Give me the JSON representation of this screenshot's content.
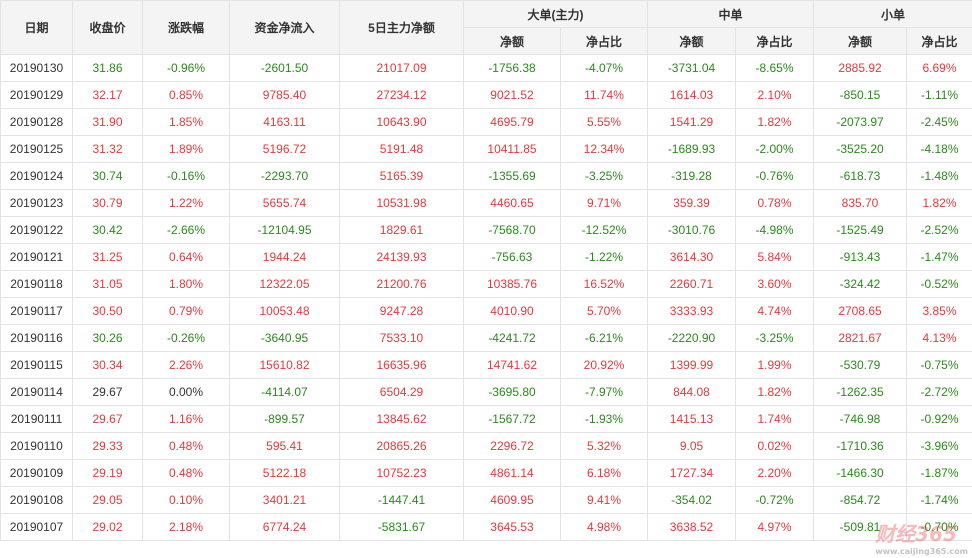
{
  "headers": {
    "date": "日期",
    "close": "收盘价",
    "change": "涨跌幅",
    "netflow": "资金净流入",
    "main5d": "5日主力净额",
    "large": "大单(主力)",
    "medium": "中单",
    "small": "小单",
    "net": "净额",
    "ratio": "净占比"
  },
  "colors": {
    "up": "#e4393c",
    "down": "#2a8a1b",
    "neutral": "#333333"
  },
  "rows": [
    {
      "date": "20190130",
      "close": "31.86",
      "change": "-0.96%",
      "netflow": "-2601.50",
      "main5d": "21017.09",
      "l_net": "-1756.38",
      "l_ratio": "-4.07%",
      "m_net": "-3731.04",
      "m_ratio": "-8.65%",
      "s_net": "2885.92",
      "s_ratio": "6.69%"
    },
    {
      "date": "20190129",
      "close": "32.17",
      "change": "0.85%",
      "netflow": "9785.40",
      "main5d": "27234.12",
      "l_net": "9021.52",
      "l_ratio": "11.74%",
      "m_net": "1614.03",
      "m_ratio": "2.10%",
      "s_net": "-850.15",
      "s_ratio": "-1.11%"
    },
    {
      "date": "20190128",
      "close": "31.90",
      "change": "1.85%",
      "netflow": "4163.11",
      "main5d": "10643.90",
      "l_net": "4695.79",
      "l_ratio": "5.55%",
      "m_net": "1541.29",
      "m_ratio": "1.82%",
      "s_net": "-2073.97",
      "s_ratio": "-2.45%"
    },
    {
      "date": "20190125",
      "close": "31.32",
      "change": "1.89%",
      "netflow": "5196.72",
      "main5d": "5191.48",
      "l_net": "10411.85",
      "l_ratio": "12.34%",
      "m_net": "-1689.93",
      "m_ratio": "-2.00%",
      "s_net": "-3525.20",
      "s_ratio": "-4.18%"
    },
    {
      "date": "20190124",
      "close": "30.74",
      "change": "-0.16%",
      "netflow": "-2293.70",
      "main5d": "5165.39",
      "l_net": "-1355.69",
      "l_ratio": "-3.25%",
      "m_net": "-319.28",
      "m_ratio": "-0.76%",
      "s_net": "-618.73",
      "s_ratio": "-1.48%"
    },
    {
      "date": "20190123",
      "close": "30.79",
      "change": "1.22%",
      "netflow": "5655.74",
      "main5d": "10531.98",
      "l_net": "4460.65",
      "l_ratio": "9.71%",
      "m_net": "359.39",
      "m_ratio": "0.78%",
      "s_net": "835.70",
      "s_ratio": "1.82%"
    },
    {
      "date": "20190122",
      "close": "30.42",
      "change": "-2.66%",
      "netflow": "-12104.95",
      "main5d": "1829.61",
      "l_net": "-7568.70",
      "l_ratio": "-12.52%",
      "m_net": "-3010.76",
      "m_ratio": "-4.98%",
      "s_net": "-1525.49",
      "s_ratio": "-2.52%"
    },
    {
      "date": "20190121",
      "close": "31.25",
      "change": "0.64%",
      "netflow": "1944.24",
      "main5d": "24139.93",
      "l_net": "-756.63",
      "l_ratio": "-1.22%",
      "m_net": "3614.30",
      "m_ratio": "5.84%",
      "s_net": "-913.43",
      "s_ratio": "-1.47%"
    },
    {
      "date": "20190118",
      "close": "31.05",
      "change": "1.80%",
      "netflow": "12322.05",
      "main5d": "21200.76",
      "l_net": "10385.76",
      "l_ratio": "16.52%",
      "m_net": "2260.71",
      "m_ratio": "3.60%",
      "s_net": "-324.42",
      "s_ratio": "-0.52%"
    },
    {
      "date": "20190117",
      "close": "30.50",
      "change": "0.79%",
      "netflow": "10053.48",
      "main5d": "9247.28",
      "l_net": "4010.90",
      "l_ratio": "5.70%",
      "m_net": "3333.93",
      "m_ratio": "4.74%",
      "s_net": "2708.65",
      "s_ratio": "3.85%"
    },
    {
      "date": "20190116",
      "close": "30.26",
      "change": "-0.26%",
      "netflow": "-3640.95",
      "main5d": "7533.10",
      "l_net": "-4241.72",
      "l_ratio": "-6.21%",
      "m_net": "-2220.90",
      "m_ratio": "-3.25%",
      "s_net": "2821.67",
      "s_ratio": "4.13%"
    },
    {
      "date": "20190115",
      "close": "30.34",
      "change": "2.26%",
      "netflow": "15610.82",
      "main5d": "16635.96",
      "l_net": "14741.62",
      "l_ratio": "20.92%",
      "m_net": "1399.99",
      "m_ratio": "1.99%",
      "s_net": "-530.79",
      "s_ratio": "-0.75%"
    },
    {
      "date": "20190114",
      "close": "29.67",
      "change": "0.00%",
      "netflow": "-4114.07",
      "main5d": "6504.29",
      "l_net": "-3695.80",
      "l_ratio": "-7.97%",
      "m_net": "844.08",
      "m_ratio": "1.82%",
      "s_net": "-1262.35",
      "s_ratio": "-2.72%"
    },
    {
      "date": "20190111",
      "close": "29.67",
      "change": "1.16%",
      "netflow": "-899.57",
      "main5d": "13845.62",
      "l_net": "-1567.72",
      "l_ratio": "-1.93%",
      "m_net": "1415.13",
      "m_ratio": "1.74%",
      "s_net": "-746.98",
      "s_ratio": "-0.92%"
    },
    {
      "date": "20190110",
      "close": "29.33",
      "change": "0.48%",
      "netflow": "595.41",
      "main5d": "20865.26",
      "l_net": "2296.72",
      "l_ratio": "5.32%",
      "m_net": "9.05",
      "m_ratio": "0.02%",
      "s_net": "-1710.36",
      "s_ratio": "-3.96%"
    },
    {
      "date": "20190109",
      "close": "29.19",
      "change": "0.48%",
      "netflow": "5122.18",
      "main5d": "10752.23",
      "l_net": "4861.14",
      "l_ratio": "6.18%",
      "m_net": "1727.34",
      "m_ratio": "2.20%",
      "s_net": "-1466.30",
      "s_ratio": "-1.87%"
    },
    {
      "date": "20190108",
      "close": "29.05",
      "change": "0.10%",
      "netflow": "3401.21",
      "main5d": "-1447.41",
      "l_net": "4609.95",
      "l_ratio": "9.41%",
      "m_net": "-354.02",
      "m_ratio": "-0.72%",
      "s_net": "-854.72",
      "s_ratio": "-1.74%"
    },
    {
      "date": "20190107",
      "close": "29.02",
      "change": "2.18%",
      "netflow": "6774.24",
      "main5d": "-5831.67",
      "l_net": "3645.53",
      "l_ratio": "4.98%",
      "m_net": "3638.52",
      "m_ratio": "4.97%",
      "s_net": "-509.81",
      "s_ratio": "-0.70%"
    }
  ],
  "watermark": {
    "brand": "财经365",
    "url": "www.caijing365.com"
  }
}
